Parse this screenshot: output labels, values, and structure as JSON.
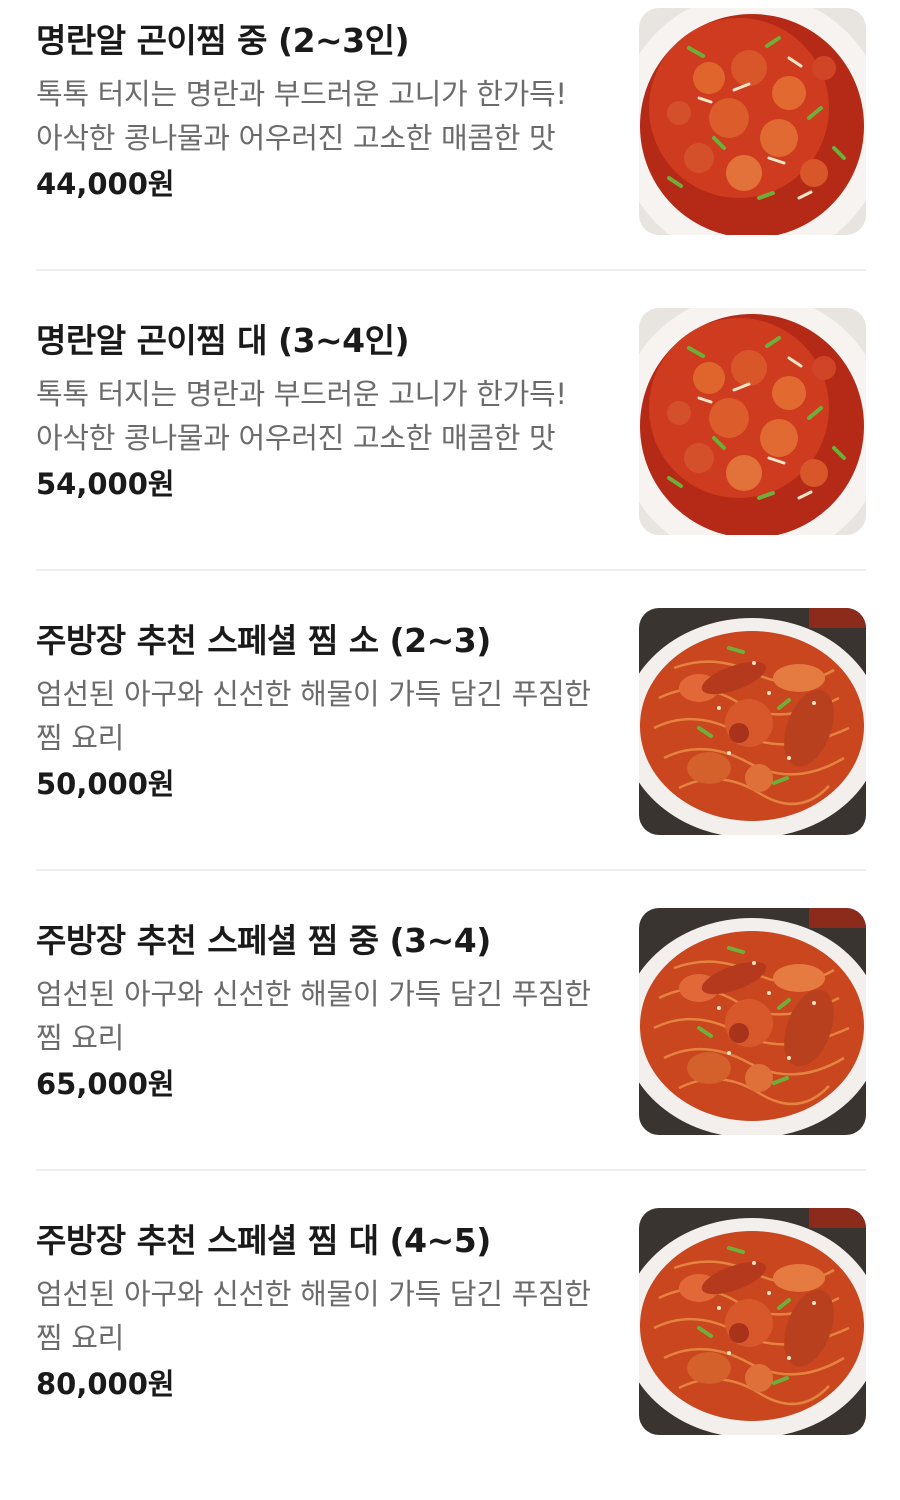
{
  "menu": {
    "items": [
      {
        "name": "명란알 곤이찜 중 (2~3인)",
        "description": "톡톡 터지는 명란과 부드러운 고니가 한가득! 아삭한 콩나물과 어우러진 고소한 매콤한 맛",
        "price": "44,000원",
        "image_icon": "spicy-roe-stew-image"
      },
      {
        "name": "명란알 곤이찜 대 (3~4인)",
        "description": "톡톡 터지는 명란과 부드러운 고니가 한가득! 아삭한 콩나물과 어우러진 고소한 매콤한 맛",
        "price": "54,000원",
        "image_icon": "spicy-roe-stew-image"
      },
      {
        "name": "주방장 추천 스페셜 찜 소 (2~3)",
        "description": "엄선된 아구와 신선한 해물이 가득 담긴 푸짐한 찜 요리",
        "price": "50,000원",
        "image_icon": "seafood-stew-image"
      },
      {
        "name": "주방장 추천 스페셜 찜 중 (3~4)",
        "description": "엄선된 아구와 신선한 해물이 가득 담긴 푸짐한 찜 요리",
        "price": "65,000원",
        "image_icon": "seafood-stew-image"
      },
      {
        "name": "주방장 추천 스페셜 찜 대 (4~5)",
        "description": "엄선된 아구와 신선한 해물이 가득 담긴 푸짐한 찜 요리",
        "price": "80,000원",
        "image_icon": "seafood-stew-image"
      }
    ]
  },
  "colors": {
    "title": "#1a1a1a",
    "description": "#6b6b6b",
    "divider": "#eeeeee",
    "sauce_red": "#c4301a",
    "plate": "#f4f1ee"
  }
}
